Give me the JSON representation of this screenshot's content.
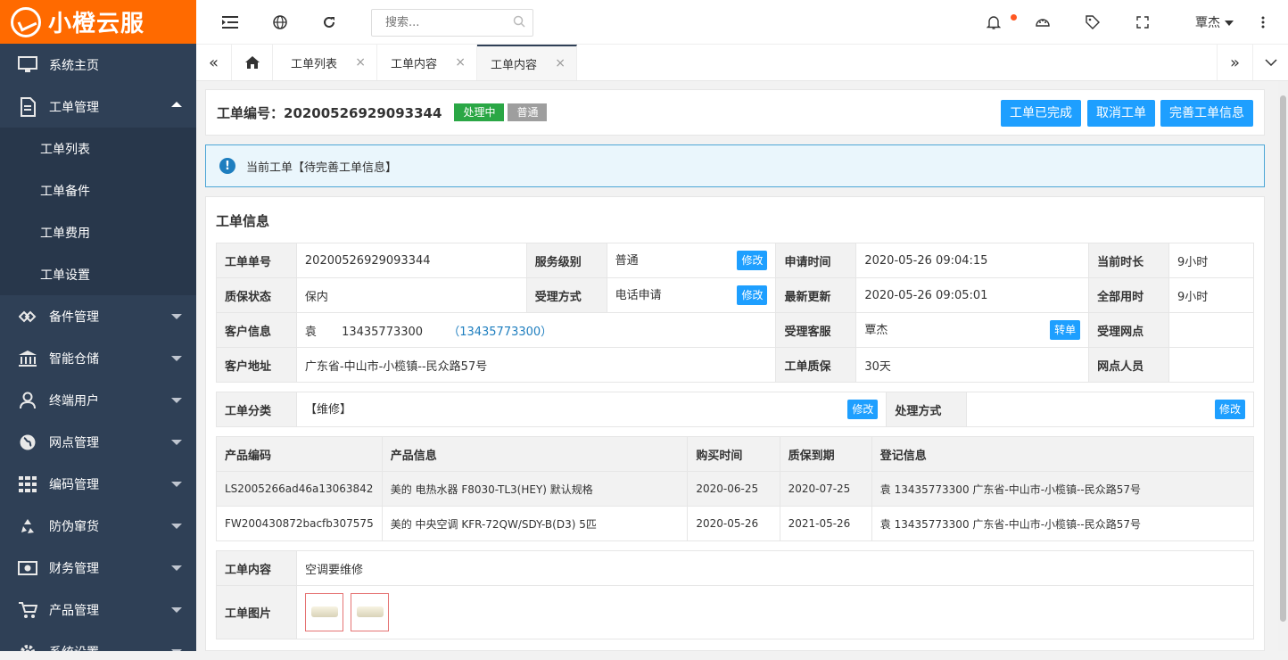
{
  "app": {
    "logo_text": "小橙云服"
  },
  "sidebar": {
    "items": [
      {
        "label": "系统主页",
        "icon": "monitor-icon"
      },
      {
        "label": "工单管理",
        "icon": "document-icon",
        "expanded": true,
        "children": [
          "工单列表",
          "工单备件",
          "工单费用",
          "工单设置"
        ]
      },
      {
        "label": "备件管理",
        "icon": "parts-icon"
      },
      {
        "label": "智能仓储",
        "icon": "bank-icon"
      },
      {
        "label": "终端用户",
        "icon": "user-icon"
      },
      {
        "label": "网点管理",
        "icon": "globe-icon"
      },
      {
        "label": "编码管理",
        "icon": "grid-icon"
      },
      {
        "label": "防伪窜货",
        "icon": "recycle-icon"
      },
      {
        "label": "财务管理",
        "icon": "money-icon"
      },
      {
        "label": "产品管理",
        "icon": "cart-icon"
      },
      {
        "label": "系统设置",
        "icon": "gear-icon"
      }
    ]
  },
  "topbar": {
    "search_placeholder": "搜索...",
    "user_name": "覃杰"
  },
  "tabs": [
    {
      "label": "工单列表"
    },
    {
      "label": "工单内容"
    },
    {
      "label": "工单内容",
      "active": true
    }
  ],
  "order": {
    "header_label": "工单编号：20200526929093344",
    "status_tag": "处理中",
    "level_tag": "普通",
    "buttons": {
      "complete": "工单已完成",
      "cancel": "取消工单",
      "improve": "完善工单信息"
    },
    "alert_text": "当前工单【待完善工单信息】",
    "section_title": "工单信息",
    "info": {
      "order_no_label": "工单单号",
      "order_no": "20200526929093344",
      "service_level_label": "服务级别",
      "service_level": "普通",
      "apply_time_label": "申请时间",
      "apply_time": "2020-05-26 09:04:15",
      "duration_label": "当前时长",
      "duration": "9小时",
      "warranty_label": "质保状态",
      "warranty": "保内",
      "accept_method_label": "受理方式",
      "accept_method": "电话申请",
      "updated_label": "最新更新",
      "updated": "2020-05-26 09:05:01",
      "total_label": "全部用时",
      "total": "9小时",
      "customer_label": "客户信息",
      "customer_name": "袁",
      "customer_phone": "13435773300",
      "customer_phone_link": "（13435773300）",
      "service_agent_label": "受理客服",
      "service_agent": "覃杰",
      "network_label": "受理网点",
      "network": "",
      "address_label": "客户地址",
      "address": "广东省-中山市-小榄镇--民众路57号",
      "order_warranty_label": "工单质保",
      "order_warranty": "30天",
      "network_staff_label": "网点人员",
      "network_staff": "",
      "modify": "修改",
      "transfer": "转单"
    },
    "category": {
      "label": "工单分类",
      "value": "【维修】",
      "method_label": "处理方式",
      "method": ""
    },
    "products": {
      "headers": [
        "产品编码",
        "产品信息",
        "购买时间",
        "质保到期",
        "登记信息"
      ],
      "rows": [
        [
          "LS2005266ad46a13063842",
          "美的 电热水器 F8030-TL3(HEY) 默认规格",
          "2020-06-25",
          "2020-07-25",
          "袁 13435773300 广东省-中山市-小榄镇--民众路57号"
        ],
        [
          "FW200430872bacfb307575",
          "美的 中央空调 KFR-72QW/SDY-B(D3) 5匹",
          "2020-05-26",
          "2021-05-26",
          "袁 13435773300 广东省-中山市-小榄镇--民众路57号"
        ]
      ]
    },
    "content_label": "工单内容",
    "content": "空调要维修",
    "images_label": "工单图片"
  },
  "colors": {
    "sidebar": "#2f4056",
    "logo": "#ff6a00",
    "primary": "#1e9fff",
    "green": "#2aa745",
    "grey": "#9e9e9e"
  }
}
